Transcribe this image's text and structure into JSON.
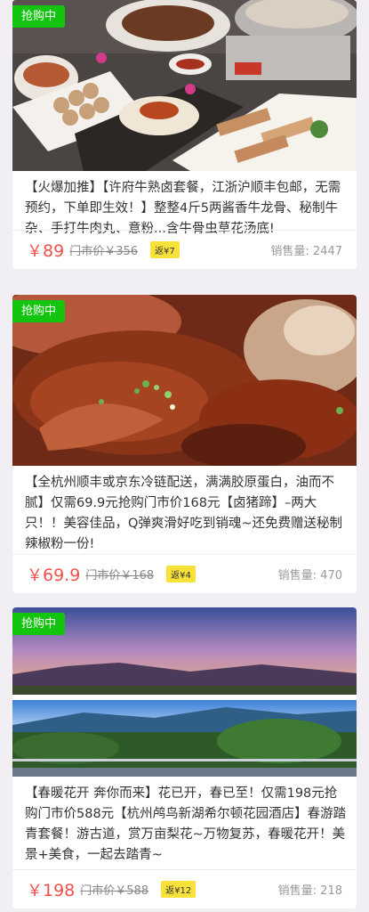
{
  "badge_label": "抢购中",
  "sales_label": "销售量:",
  "colors": {
    "accent": "#f0504d",
    "badge_green": "#13c50e",
    "rebate_yellow": "#f8e23a"
  },
  "products": [
    {
      "description": "【火爆加推】【许府牛熟卤套餐，江浙沪顺丰包邮，无需预约，下单即生效！】整整4斤5两酱香牛龙骨、秘制牛杂、手打牛肉丸、意粉...含牛骨虫草花汤底!",
      "price_symbol": "￥",
      "price": "89",
      "original_price": "门市价￥356",
      "rebate": "返¥7",
      "sales": "2447",
      "image": "hotpot-spread-photo"
    },
    {
      "description": "【全杭州顺丰或京东冷链配送，满满胶原蛋白，油而不腻】仅需69.9元抢购门市价168元【卤猪蹄】–两大只！！美容佳品，Q弹爽滑好吃到销魂~还免费赠送秘制辣椒粉一份!",
      "price_symbol": "￥",
      "price": "69.9",
      "original_price": "门市价￥168",
      "rebate": "返¥4",
      "sales": "470",
      "image": "braised-pork-trotter-photo"
    },
    {
      "description": "【春暖花开 奔你而来】花已开，春已至！仅需198元抢购门市价588元【杭州鸬鸟新湖希尔顿花园酒店】春游踏青套餐！游古道，赏万亩梨花~万物复苏，春暖花开！美景+美食，一起去踏青~",
      "price_symbol": "￥",
      "price": "198",
      "original_price": "门市价￥588",
      "rebate": "返¥12",
      "sales": "218",
      "image": "mountain-landscape-photo"
    }
  ]
}
